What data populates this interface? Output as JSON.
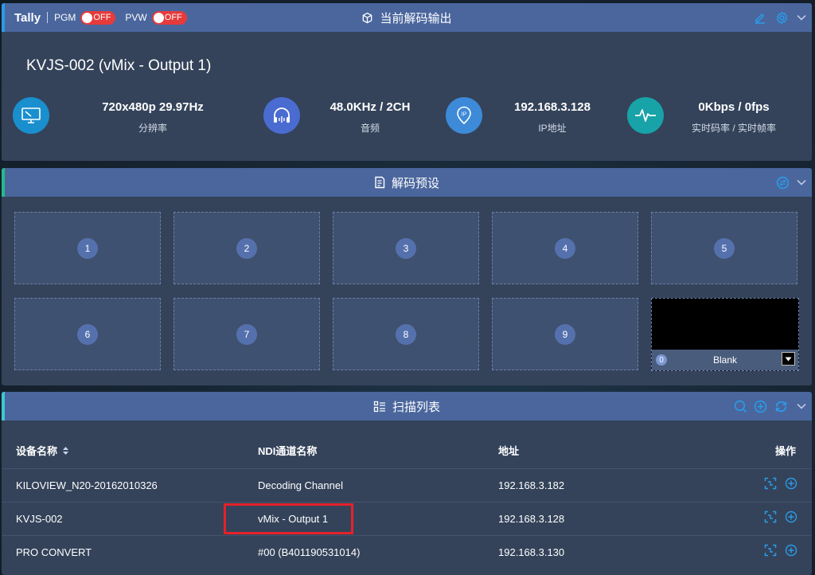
{
  "decode_output": {
    "tally": {
      "label": "Tally",
      "pgm_label": "PGM",
      "pgm_state": "OFF",
      "pvw_label": "PVW",
      "pvw_state": "OFF"
    },
    "title": "当前解码输出",
    "device_name": "KVJS-002 (vMix - Output 1)",
    "stats": [
      {
        "icon": "monitor-icon",
        "value": "720x480p 29.97Hz",
        "label": "分辨率",
        "color": "#1a8fce"
      },
      {
        "icon": "headphones-icon",
        "value": "48.0KHz / 2CH",
        "label": "音频",
        "color": "#4a6cd0"
      },
      {
        "icon": "ip-pin-icon",
        "value": "192.168.3.128",
        "label": "IP地址",
        "color": "#3d8ad8"
      },
      {
        "icon": "pulse-icon",
        "value": "0Kbps / 0fps",
        "label": "实时码率 / 实时帧率",
        "color": "#17a3a8"
      }
    ]
  },
  "presets": {
    "title": "解码预设",
    "items": [
      "1",
      "2",
      "3",
      "4",
      "5",
      "6",
      "7",
      "8",
      "9"
    ],
    "blank": {
      "number": "0",
      "label": "Blank"
    }
  },
  "scan_list": {
    "title": "扫描列表",
    "columns": {
      "device": "设备名称",
      "channel": "NDI通道名称",
      "address": "地址",
      "actions": "操作"
    },
    "rows": [
      {
        "device": "KILOVIEW_N20-20162010326",
        "channel": "Decoding Channel",
        "address": "192.168.3.182"
      },
      {
        "device": "KVJS-002",
        "channel": "vMix - Output 1",
        "address": "192.168.3.128"
      },
      {
        "device": "PRO CONVERT",
        "channel": "#00 (B401190531014)",
        "address": "192.168.3.130"
      }
    ]
  },
  "colors": {
    "accent_blue": "#2b9be8",
    "header_bg": "#4a669d",
    "panel_bg": "#34435a",
    "toggle_off": "#e63b3b",
    "highlight": "#e5212b"
  }
}
